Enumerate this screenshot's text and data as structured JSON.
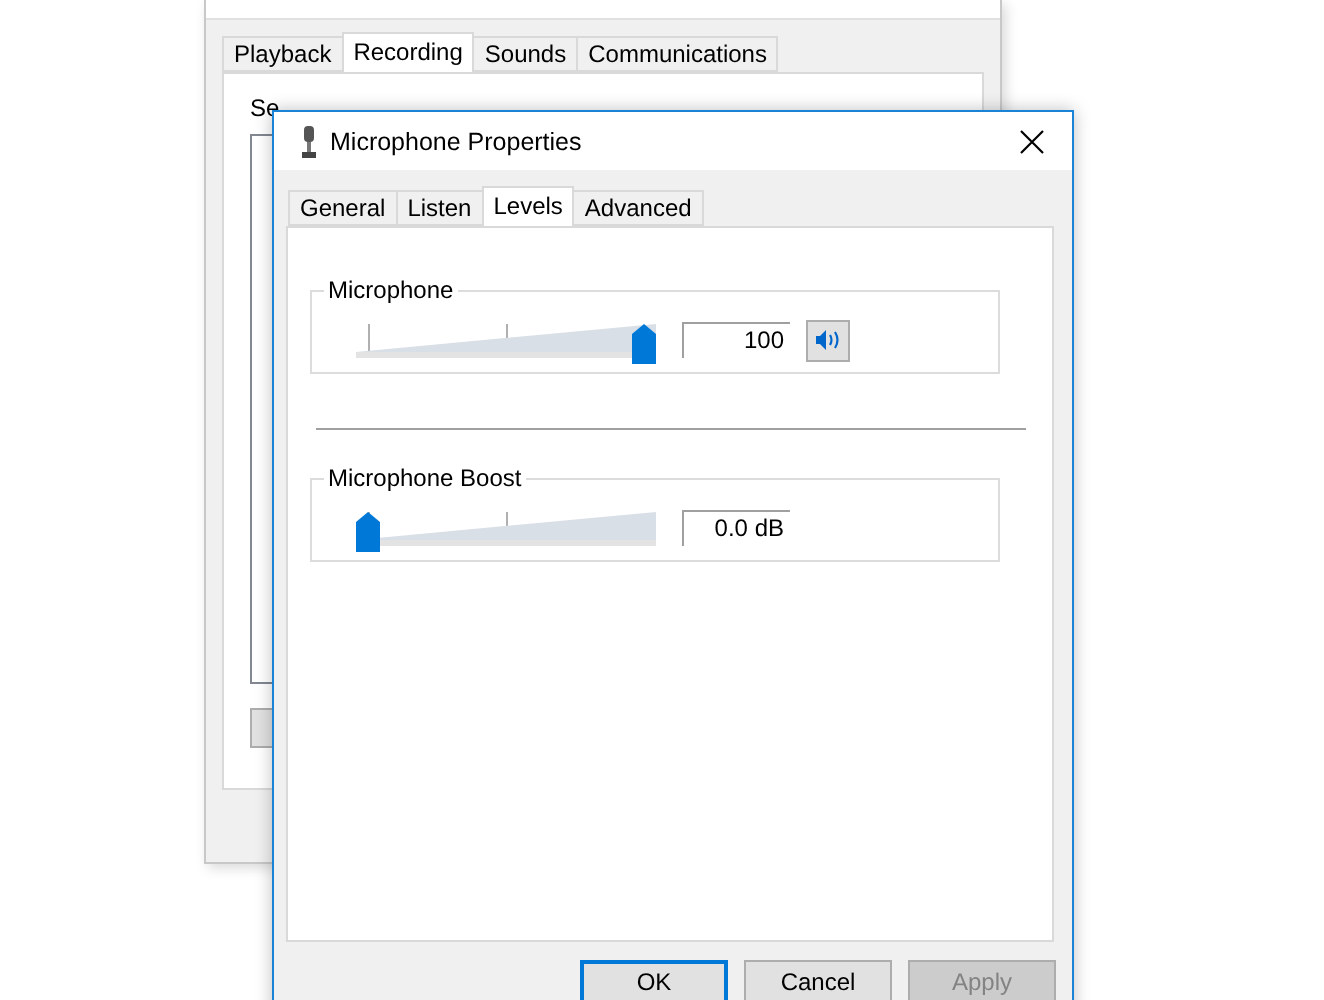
{
  "background_window": {
    "tabs": [
      {
        "label": "Playback",
        "selected": false
      },
      {
        "label": "Recording",
        "selected": true
      },
      {
        "label": "Sounds",
        "selected": false
      },
      {
        "label": "Communications",
        "selected": false
      }
    ],
    "instruction": "Se"
  },
  "dialog": {
    "title": "Microphone Properties",
    "tabs": [
      {
        "label": "General",
        "selected": false
      },
      {
        "label": "Listen",
        "selected": false
      },
      {
        "label": "Levels",
        "selected": true
      },
      {
        "label": "Advanced",
        "selected": false
      }
    ],
    "levels": [
      {
        "name": "Microphone",
        "level": 1,
        "reading": "100",
        "muted": false
      },
      {
        "name": "Microphone Boost",
        "level": 0,
        "reading": "0.0 dB"
      }
    ],
    "buttons": [
      {
        "label": "OK",
        "default": true,
        "disabled": false
      },
      {
        "label": "Cancel",
        "default": false,
        "disabled": false
      },
      {
        "label": "Apply",
        "default": false,
        "disabled": true
      }
    ]
  }
}
